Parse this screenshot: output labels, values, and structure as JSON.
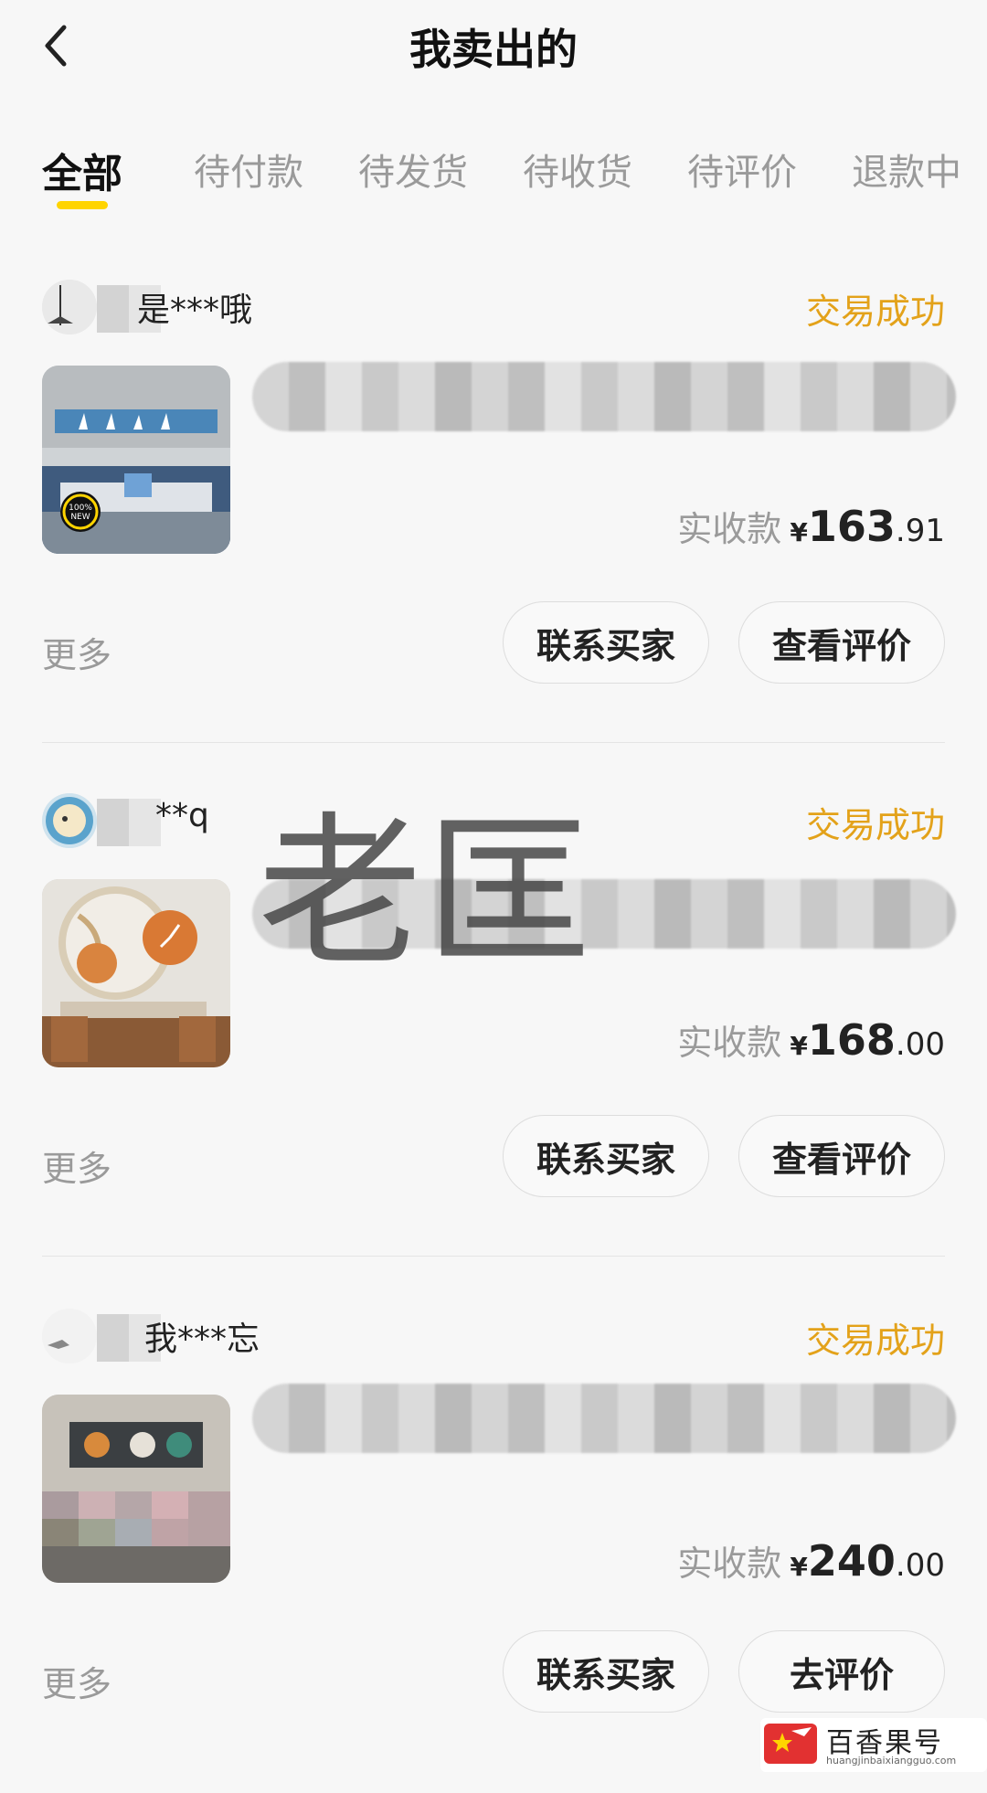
{
  "header": {
    "title": "我卖出的",
    "back_icon": "chevron-left-icon"
  },
  "tabs": [
    {
      "label": "全部",
      "active": true
    },
    {
      "label": "待付款"
    },
    {
      "label": "待发货"
    },
    {
      "label": "待收货"
    },
    {
      "label": "待评价"
    },
    {
      "label": "退款中"
    }
  ],
  "orders": [
    {
      "buyer": "是***哦",
      "status": "交易成功",
      "price_label": "实收款",
      "currency": "¥",
      "price_int": "163",
      "price_dec": ".91",
      "more": "更多",
      "contact_label": "联系买家",
      "review_label": "查看评价"
    },
    {
      "buyer": "**q",
      "status": "交易成功",
      "price_label": "实收款",
      "currency": "¥",
      "price_int": "168",
      "price_dec": ".00",
      "more": "更多",
      "contact_label": "联系买家",
      "review_label": "查看评价"
    },
    {
      "buyer": "我***忘",
      "status": "交易成功",
      "price_label": "实收款",
      "currency": "¥",
      "price_int": "240",
      "price_dec": ".00",
      "more": "更多",
      "contact_label": "联系买家",
      "review_label": "去评价"
    }
  ],
  "watermark": "老匡",
  "site_logo": {
    "text": "百香果号",
    "sub": "huangjinbaixiangguo.com"
  },
  "colors": {
    "accent_yellow": "#ffd400",
    "status_orange": "#e3a21a",
    "background": "#f7f7f7"
  }
}
